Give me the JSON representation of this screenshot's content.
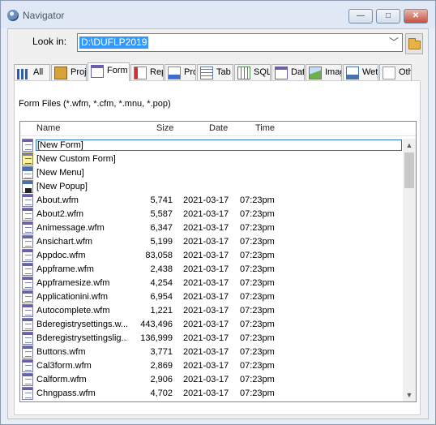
{
  "window": {
    "title": "Navigator",
    "min_glyph": "—",
    "max_glyph": "□",
    "close_glyph": "✕"
  },
  "lookin": {
    "label": "Look in:",
    "value": "D:\\DUFLP2019",
    "chevron": "﹀"
  },
  "tabs": [
    {
      "label": "All",
      "icon": "all-icon",
      "active": false
    },
    {
      "label": "Proj",
      "icon": "project-icon",
      "active": false
    },
    {
      "label": "Form",
      "icon": "form-icon",
      "active": true
    },
    {
      "label": "Rep",
      "icon": "report-icon",
      "active": false
    },
    {
      "label": "Prog",
      "icon": "program-icon",
      "active": false
    },
    {
      "label": "Tab",
      "icon": "table-icon",
      "active": false
    },
    {
      "label": "SQL",
      "icon": "sql-icon",
      "active": false
    },
    {
      "label": "Data",
      "icon": "datamodule-icon",
      "active": false
    },
    {
      "label": "Imag",
      "icon": "image-icon",
      "active": false
    },
    {
      "label": "Wet",
      "icon": "web-icon",
      "active": false
    },
    {
      "label": "Othe",
      "icon": "other-icon",
      "active": false
    }
  ],
  "filter_text": "Form Files (*.wfm, *.cfm, *.mnu, *.pop)",
  "columns": {
    "name": "Name",
    "size": "Size",
    "date": "Date",
    "time": "Time"
  },
  "rows": [
    {
      "name": "[New Form]",
      "size": "",
      "date": "",
      "time": "",
      "icon": "form",
      "selected": true
    },
    {
      "name": "[New Custom Form]",
      "size": "",
      "date": "",
      "time": "",
      "icon": "custom"
    },
    {
      "name": "[New Menu]",
      "size": "",
      "date": "",
      "time": "",
      "icon": "menu"
    },
    {
      "name": "[New Popup]",
      "size": "",
      "date": "",
      "time": "",
      "icon": "popup"
    },
    {
      "name": "About.wfm",
      "size": "5,741",
      "date": "2021-03-17",
      "time": "07:23pm",
      "icon": "form"
    },
    {
      "name": "About2.wfm",
      "size": "5,587",
      "date": "2021-03-17",
      "time": "07:23pm",
      "icon": "form"
    },
    {
      "name": "Animessage.wfm",
      "size": "6,347",
      "date": "2021-03-17",
      "time": "07:23pm",
      "icon": "form"
    },
    {
      "name": "Ansichart.wfm",
      "size": "5,199",
      "date": "2021-03-17",
      "time": "07:23pm",
      "icon": "form"
    },
    {
      "name": "Appdoc.wfm",
      "size": "83,058",
      "date": "2021-03-17",
      "time": "07:23pm",
      "icon": "form"
    },
    {
      "name": "Appframe.wfm",
      "size": "2,438",
      "date": "2021-03-17",
      "time": "07:23pm",
      "icon": "form"
    },
    {
      "name": "Appframesize.wfm",
      "size": "4,254",
      "date": "2021-03-17",
      "time": "07:23pm",
      "icon": "form"
    },
    {
      "name": "Applicationini.wfm",
      "size": "6,954",
      "date": "2021-03-17",
      "time": "07:23pm",
      "icon": "form"
    },
    {
      "name": "Autocomplete.wfm",
      "size": "1,221",
      "date": "2021-03-17",
      "time": "07:23pm",
      "icon": "form"
    },
    {
      "name": "Bderegistrysettings.w...",
      "size": "443,496",
      "date": "2021-03-17",
      "time": "07:23pm",
      "icon": "form"
    },
    {
      "name": "Bderegistrysettingslig...",
      "size": "136,999",
      "date": "2021-03-17",
      "time": "07:23pm",
      "icon": "form"
    },
    {
      "name": "Buttons.wfm",
      "size": "3,771",
      "date": "2021-03-17",
      "time": "07:23pm",
      "icon": "form"
    },
    {
      "name": "Cal3form.wfm",
      "size": "2,869",
      "date": "2021-03-17",
      "time": "07:23pm",
      "icon": "form"
    },
    {
      "name": "Calform.wfm",
      "size": "2,906",
      "date": "2021-03-17",
      "time": "07:23pm",
      "icon": "form"
    },
    {
      "name": "Chngpass.wfm",
      "size": "4,702",
      "date": "2021-03-17",
      "time": "07:23pm",
      "icon": "form"
    }
  ],
  "scroll": {
    "up_glyph": "▲",
    "down_glyph": "▼",
    "position_fraction": 0.0
  }
}
